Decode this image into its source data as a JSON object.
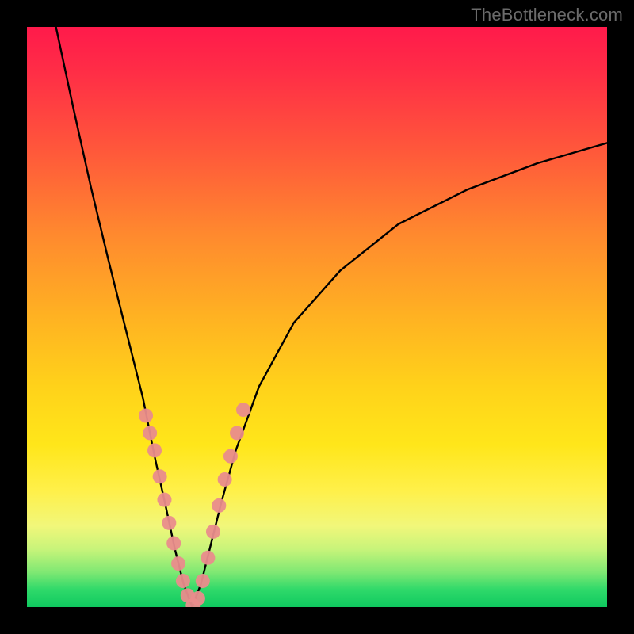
{
  "watermark": "TheBottleneck.com",
  "chart_data": {
    "type": "line",
    "title": "",
    "xlabel": "",
    "ylabel": "",
    "xlim": [
      0,
      100
    ],
    "ylim": [
      0,
      100
    ],
    "grid": false,
    "legend": false,
    "annotations": [],
    "series": [
      {
        "name": "curve-left",
        "color": "#000000",
        "x": [
          5,
          8,
          11,
          14,
          17,
          20,
          22,
          24,
          25.5,
          27,
          28.5
        ],
        "y": [
          100,
          86,
          72.5,
          60,
          48,
          36,
          26,
          17,
          10,
          4,
          0
        ]
      },
      {
        "name": "curve-right",
        "color": "#000000",
        "x": [
          28.5,
          30,
          31.5,
          33.5,
          36,
          40,
          46,
          54,
          64,
          76,
          88,
          100
        ],
        "y": [
          0,
          4,
          10,
          18,
          27,
          38,
          49,
          58,
          66,
          72,
          76.5,
          80
        ]
      },
      {
        "name": "markers-left",
        "color": "#e98c8c",
        "type": "scatter",
        "x": [
          20.5,
          21.2,
          22.0,
          22.9,
          23.7,
          24.5,
          25.3,
          26.1,
          26.9,
          27.7,
          28.6
        ],
        "y": [
          33.0,
          30.0,
          27.0,
          22.5,
          18.5,
          14.5,
          11.0,
          7.5,
          4.5,
          2.0,
          0.3
        ]
      },
      {
        "name": "markers-right",
        "color": "#e98c8c",
        "type": "scatter",
        "x": [
          29.5,
          30.3,
          31.2,
          32.1,
          33.1,
          34.1,
          35.1,
          36.2,
          37.3
        ],
        "y": [
          1.5,
          4.5,
          8.5,
          13.0,
          17.5,
          22.0,
          26.0,
          30.0,
          34.0
        ]
      }
    ]
  }
}
